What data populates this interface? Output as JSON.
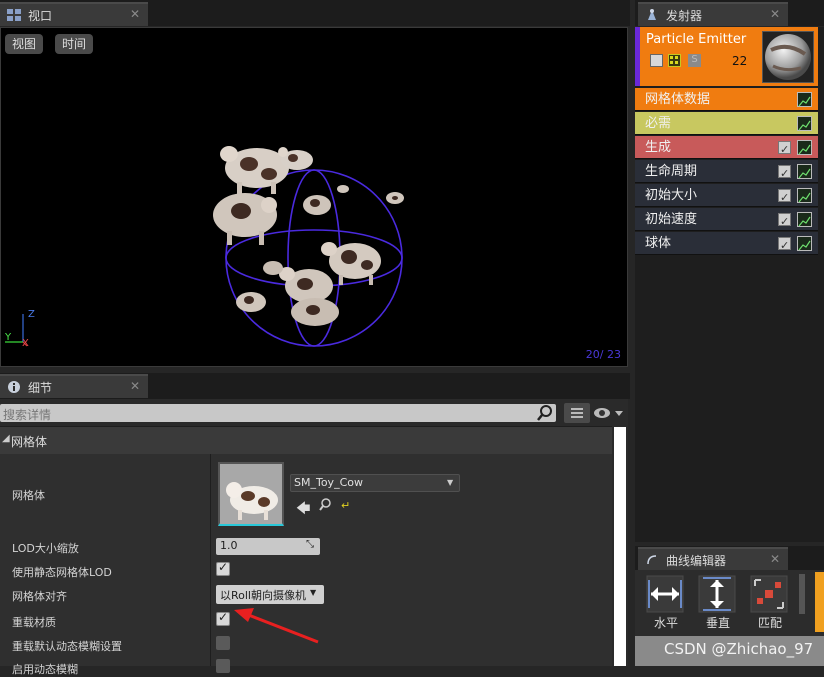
{
  "viewport_tab": {
    "title": "视口"
  },
  "viewport": {
    "buttons": [
      "视图",
      "时间"
    ],
    "frame_count": "20/ 23",
    "axis": {
      "z": "Z",
      "y": "Y",
      "x": "X"
    }
  },
  "emitter_tab": {
    "title": "发射器"
  },
  "emitter": {
    "name": "Particle Emitter",
    "count": "22",
    "s_label": "S",
    "modules": [
      {
        "label": "网格体数据",
        "color": "#f07c10",
        "has_check": false
      },
      {
        "label": "必需",
        "color": "#c8c860",
        "has_check": false
      },
      {
        "label": "生成",
        "color": "#c85a5a",
        "has_check": true
      },
      {
        "label": "生命周期",
        "color": "#2a2e38",
        "has_check": true
      },
      {
        "label": "初始大小",
        "color": "#2a2e38",
        "has_check": true
      },
      {
        "label": "初始速度",
        "color": "#2a2e38",
        "has_check": true
      },
      {
        "label": "球体",
        "color": "#2a2e38",
        "has_check": true
      }
    ]
  },
  "details_tab": {
    "title": "细节"
  },
  "details": {
    "search_placeholder": "搜索详情",
    "section": "网格体",
    "mesh_label": "网格体",
    "mesh_value": "SM_Toy_Cow",
    "rows": [
      {
        "label": "LOD大小缩放",
        "value": "1.0"
      },
      {
        "label": "使用静态网格体LOD",
        "checked": true
      },
      {
        "label": "网格体对齐",
        "value": "以Roll朝向摄像机"
      },
      {
        "label": "重载材质",
        "checked": true
      },
      {
        "label": "重载默认动态模糊设置",
        "checked": false
      },
      {
        "label": "启用动态模糊",
        "checked": false
      }
    ]
  },
  "curve_tab": {
    "title": "曲线编辑器"
  },
  "curve": {
    "buttons": [
      "水平",
      "垂直",
      "匹配"
    ]
  },
  "watermark": "CSDN @Zhichao_97",
  "colors": {
    "accent_orange": "#f07c10",
    "purple": "#6a28d8",
    "viewport_bg": "#000000"
  }
}
